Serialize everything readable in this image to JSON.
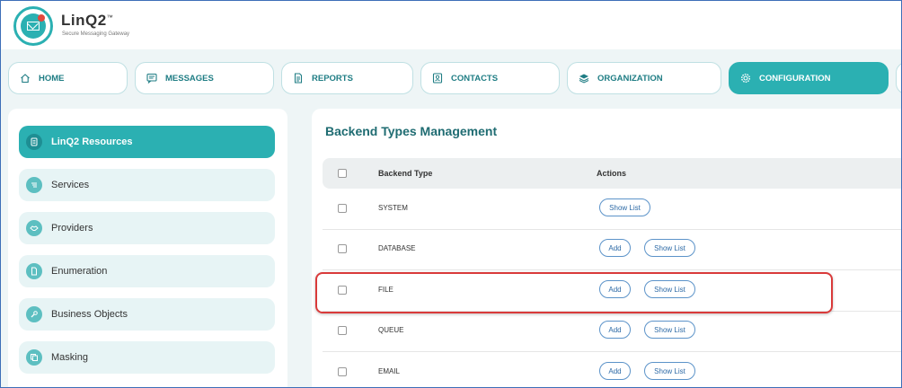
{
  "app": {
    "brand": "LinQ2",
    "trademark": "™",
    "tagline": "Secure Messaging Gateway"
  },
  "nav": {
    "items": [
      {
        "label": "HOME",
        "icon": "home-icon"
      },
      {
        "label": "MESSAGES",
        "icon": "message-icon"
      },
      {
        "label": "REPORTS",
        "icon": "document-icon"
      },
      {
        "label": "CONTACTS",
        "icon": "contact-card-icon"
      },
      {
        "label": "ORGANIZATION",
        "icon": "layers-icon"
      },
      {
        "label": "CONFIGURATION",
        "icon": "gear-icon",
        "active": true
      }
    ]
  },
  "sidebar": {
    "items": [
      {
        "label": "LinQ2 Resources",
        "icon": "list-icon",
        "active": true
      },
      {
        "label": "Services",
        "icon": "filter-list-icon"
      },
      {
        "label": "Providers",
        "icon": "handshake-icon"
      },
      {
        "label": "Enumeration",
        "icon": "file-icon"
      },
      {
        "label": "Business Objects",
        "icon": "wrench-icon"
      },
      {
        "label": "Masking",
        "icon": "copy-icon"
      }
    ]
  },
  "main": {
    "title": "Backend Types Management",
    "table": {
      "columns": {
        "type": "Backend Type",
        "actions": "Actions"
      },
      "rows": [
        {
          "type": "SYSTEM",
          "add": "",
          "show": "Show List"
        },
        {
          "type": "DATABASE",
          "add": "Add",
          "show": "Show List"
        },
        {
          "type": "FILE",
          "add": "Add",
          "show": "Show List",
          "highlighted": true
        },
        {
          "type": "QUEUE",
          "add": "Add",
          "show": "Show List"
        },
        {
          "type": "EMAIL",
          "add": "Add",
          "show": "Show List"
        }
      ]
    }
  },
  "colors": {
    "accent": "#2bb0b2",
    "title": "#1f6c72",
    "highlight": "#d93a3a"
  }
}
